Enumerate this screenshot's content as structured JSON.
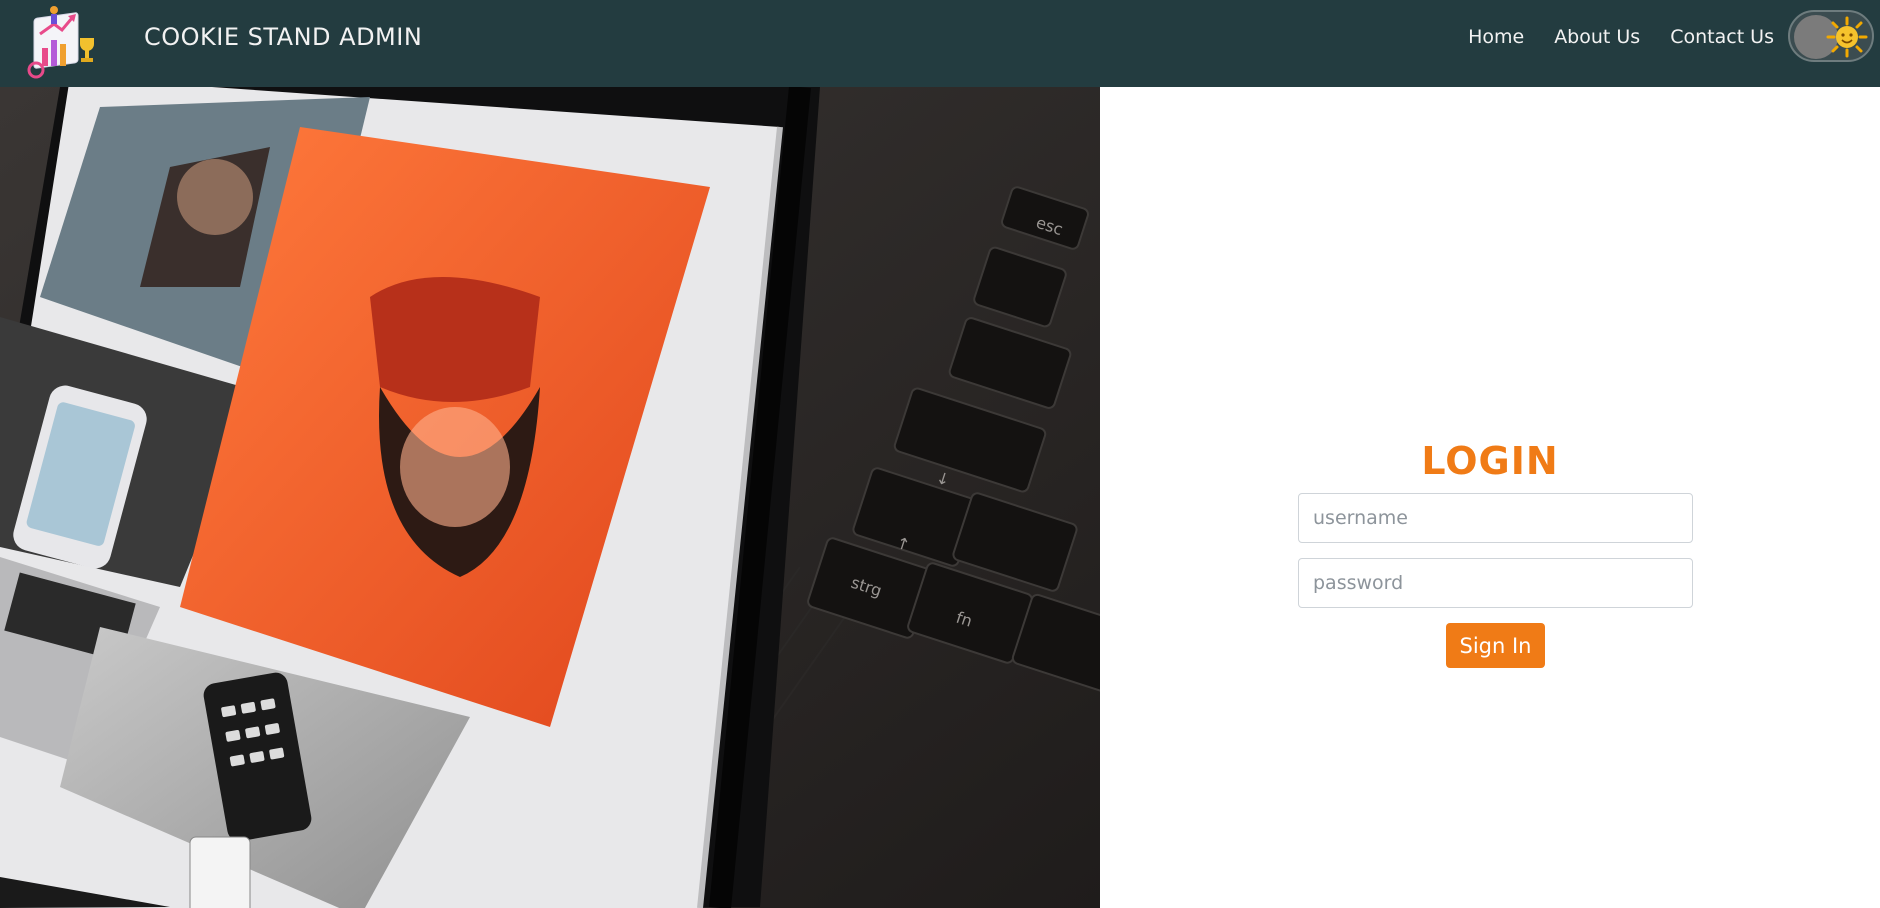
{
  "header": {
    "brand_title": "COOKIE STAND ADMIN",
    "nav": [
      {
        "label": "Home"
      },
      {
        "label": "About Us"
      },
      {
        "label": "Contact Us"
      }
    ],
    "theme_toggle": {
      "state": "off",
      "icon": "sun-icon"
    }
  },
  "login": {
    "title": "LOGIN",
    "username_placeholder": "username",
    "password_placeholder": "password",
    "submit_label": "Sign In"
  },
  "colors": {
    "navbar_bg": "#233c40",
    "accent": "#f07b16",
    "nav_text": "#f2f2f2"
  }
}
